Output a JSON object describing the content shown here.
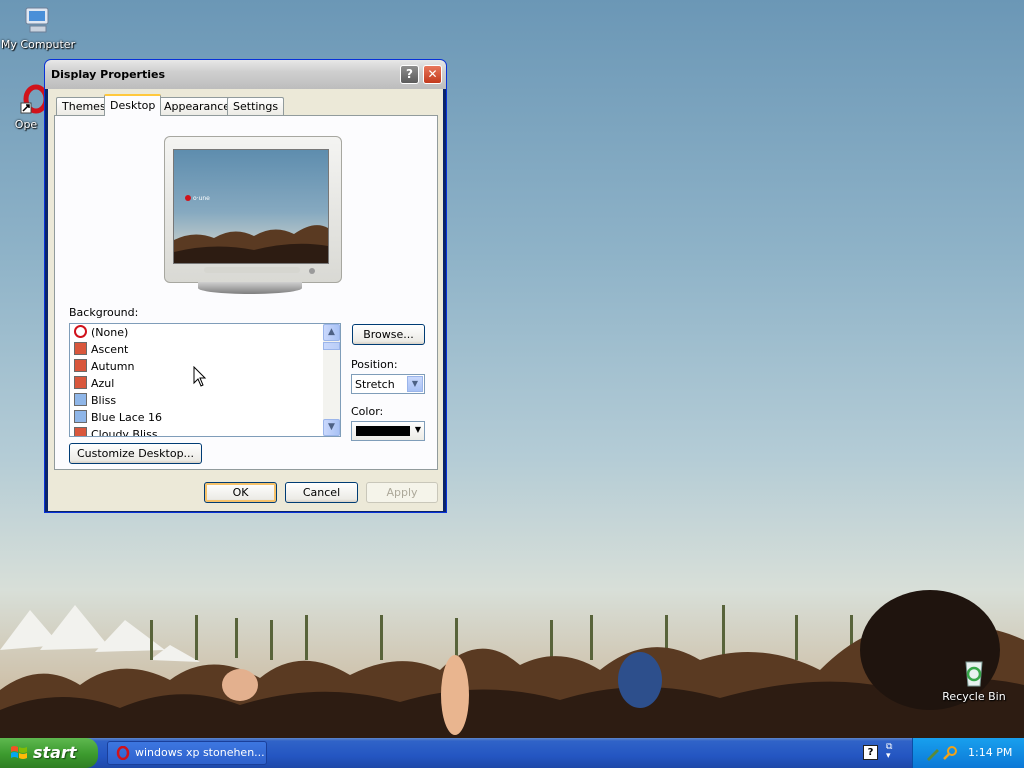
{
  "desktop": {
    "icons": {
      "my_computer": "My Computer",
      "opera": "Ope",
      "recycle_bin": "Recycle Bin"
    }
  },
  "window": {
    "title": "Display Properties",
    "help_glyph": "?",
    "close_glyph": "✕",
    "tabs": [
      "Themes",
      "Desktop",
      "Appearance",
      "Settings"
    ],
    "active_tab": "Desktop",
    "background_label": "Background:",
    "background_items": [
      "(None)",
      "Ascent",
      "Autumn",
      "Azul",
      "Bliss",
      "Blue Lace 16",
      "Cloudy Bliss"
    ],
    "browse_label": "Browse...",
    "position_label": "Position:",
    "position_value": "Stretch",
    "color_label": "Color:",
    "color_value": "#000000",
    "customize_label": "Customize Desktop...",
    "ok_label": "OK",
    "cancel_label": "Cancel",
    "apply_label": "Apply"
  },
  "taskbar": {
    "start_label": "start",
    "task_label": "windows xp stonehen...",
    "clock": "1:14 PM"
  },
  "colors": {
    "title_bar": "#cfcfcf",
    "taskbar": "#2456c2",
    "start_button": "#3c9a2e",
    "tray": "#0c78d6"
  }
}
